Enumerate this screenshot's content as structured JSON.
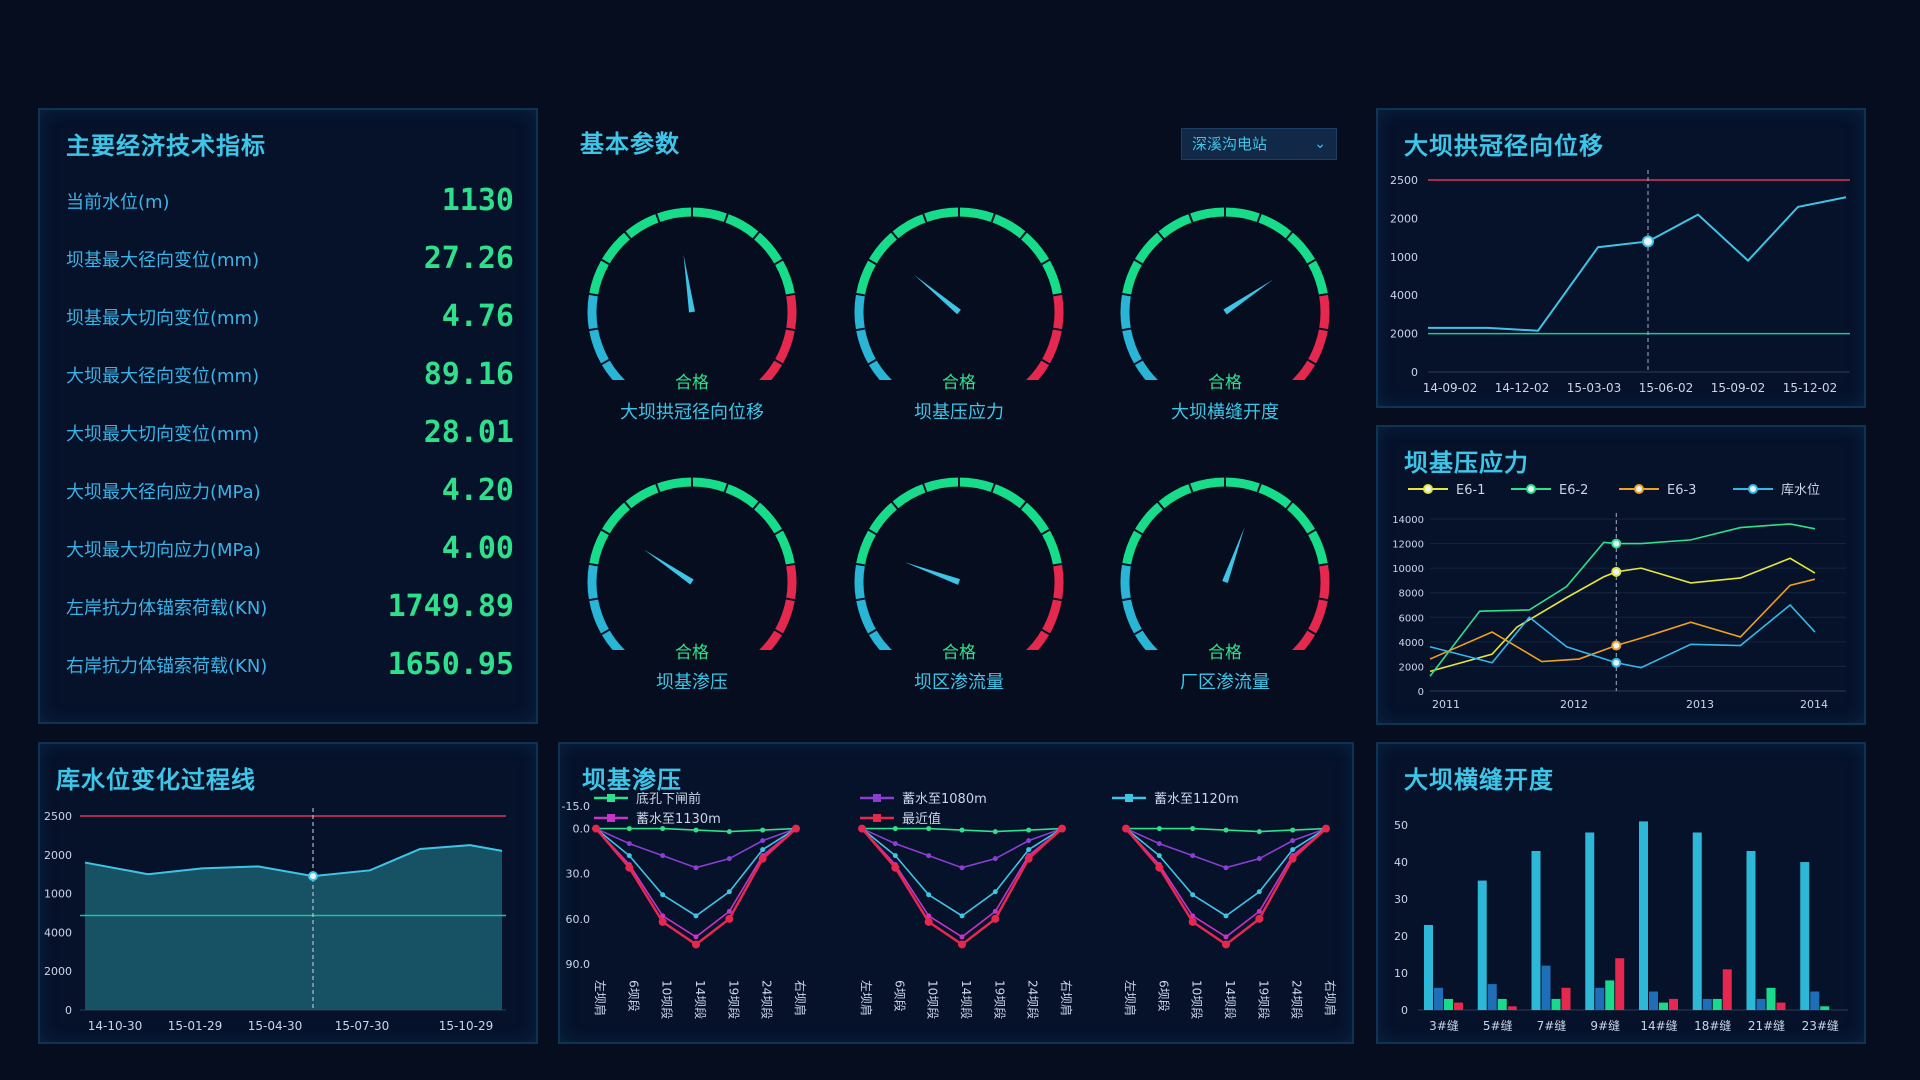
{
  "indicators": {
    "title": "主要经济技术指标",
    "items": [
      {
        "label": "当前水位(m)",
        "value": "1130"
      },
      {
        "label": "坝基最大径向变位(mm)",
        "value": "27.26"
      },
      {
        "label": "坝基最大切向变位(mm)",
        "value": "4.76"
      },
      {
        "label": "大坝最大径向变位(mm)",
        "value": "89.16"
      },
      {
        "label": "大坝最大切向变位(mm)",
        "value": "28.01"
      },
      {
        "label": "大坝最大径向应力(MPa)",
        "value": "4.20"
      },
      {
        "label": "大坝最大切向应力(MPa)",
        "value": "4.00"
      },
      {
        "label": "左岸抗力体锚索荷载(KN)",
        "value": "1749.89"
      },
      {
        "label": "右岸抗力体锚索荷载(KN)",
        "value": "1650.95"
      }
    ]
  },
  "params": {
    "title": "基本参数",
    "station_select": "深溪沟电站",
    "gauges": [
      {
        "name": "大坝拱冠径向位移",
        "status": "合格",
        "level": 0.47
      },
      {
        "name": "坝基压应力",
        "status": "合格",
        "level": 0.32
      },
      {
        "name": "大坝横缝开度",
        "status": "合格",
        "level": 0.7
      },
      {
        "name": "坝基渗压",
        "status": "合格",
        "level": 0.3
      },
      {
        "name": "坝区渗流量",
        "status": "合格",
        "level": 0.25
      },
      {
        "name": "厂区渗流量",
        "status": "合格",
        "level": 0.57
      }
    ]
  },
  "crown": {
    "title": "大坝拱冠径向位移",
    "colors": {
      "line": "#3fc4e6",
      "upper": "#e0325a",
      "lower": "#19c79a"
    }
  },
  "foundation_stress": {
    "title": "坝基压应力",
    "colors": [
      "#e6e63a",
      "#2ee08c",
      "#f0a020",
      "#35b8e8"
    ]
  },
  "reservoir": {
    "title": "库水位变化过程线"
  },
  "seepage": {
    "title": "坝基渗压",
    "colors": [
      "#2ee08c",
      "#8a3fd0",
      "#3fc4e6",
      "#c436c8",
      "#e6284e"
    ]
  },
  "joints": {
    "title": "大坝横缝开度",
    "colors": [
      "#2eb8d8",
      "#1f6fb8",
      "#19d98a",
      "#e6284e"
    ]
  },
  "chart_data": [
    {
      "type": "line",
      "title": "大坝拱冠径向位移",
      "x": [
        "14-09-02",
        "14-12-02",
        "15-03-03",
        "15-06-02",
        "15-09-02",
        "15-12-02"
      ],
      "ytick_labels": [
        "0",
        "2000",
        "4000",
        "1000",
        "2000",
        "2500"
      ],
      "series": [
        {
          "values": [
            0.77,
            0.77,
            0.785,
            0.35,
            0.32,
            0.18,
            0.42,
            0.14,
            0.09
          ]
        }
      ],
      "reference_lines": [
        0.0,
        0.8
      ],
      "highlight_x": "15-06-02",
      "grid": false
    },
    {
      "type": "line",
      "title": "坝基压应力",
      "x_ticks": [
        "2011",
        "2012",
        "2013",
        "2014"
      ],
      "y_ticks": [
        0,
        2000,
        4000,
        6000,
        8000,
        10000,
        12000,
        14000
      ],
      "ylim": [
        0,
        14000
      ],
      "series": [
        {
          "name": "E6-1",
          "x": [
            2010.9,
            2011.4,
            2011.6,
            2012.0,
            2012.3,
            2012.4,
            2012.6,
            2013.0,
            2013.4,
            2013.8,
            2014.0
          ],
          "values": [
            1600,
            3000,
            5200,
            7600,
            9300,
            9700,
            10000,
            8800,
            9200,
            10800,
            9600
          ]
        },
        {
          "name": "E6-2",
          "x": [
            2010.9,
            2011.3,
            2011.7,
            2012.0,
            2012.3,
            2012.4,
            2012.6,
            2013.0,
            2013.4,
            2013.8,
            2014.0
          ],
          "values": [
            1200,
            6500,
            6600,
            8500,
            12100,
            12000,
            12000,
            12300,
            13300,
            13600,
            13200
          ]
        },
        {
          "name": "E6-3",
          "x": [
            2010.9,
            2011.4,
            2011.8,
            2012.1,
            2012.4,
            2012.6,
            2013.0,
            2013.4,
            2013.8,
            2014.0
          ],
          "values": [
            2600,
            4800,
            2400,
            2600,
            3700,
            4300,
            5600,
            4400,
            8600,
            9100
          ]
        },
        {
          "name": "库水位",
          "x": [
            2010.9,
            2011.4,
            2011.7,
            2012.0,
            2012.4,
            2012.6,
            2013.0,
            2013.4,
            2013.8,
            2014.0
          ],
          "values": [
            3600,
            2300,
            6000,
            3600,
            2300,
            1900,
            3800,
            3700,
            7000,
            4800
          ]
        }
      ],
      "highlight_x": 2012.4,
      "legend": "top"
    },
    {
      "type": "area",
      "title": "库水位变化过程线",
      "x": [
        "14-10-30",
        "15-01-29",
        "15-04-30",
        "15-07-30",
        "15-10-29"
      ],
      "ytick_labels": [
        "0",
        "2000",
        "4000",
        "1000",
        "2000",
        "2500"
      ],
      "series": [
        {
          "values": [
            0.24,
            0.3,
            0.27,
            0.26,
            0.31,
            0.28,
            0.17,
            0.15,
            0.18
          ]
        }
      ],
      "reference_lines": [
        0.0,
        0.82
      ],
      "highlight_x": "15-04-30"
    },
    {
      "type": "line",
      "title": "坝基渗压",
      "categories": [
        "左坝肩",
        "6坝段",
        "10坝段",
        "14坝段",
        "19坝段",
        "24坝段",
        "右坝肩"
      ],
      "y_ticks": [
        "-15.0",
        "0.0",
        "30.0",
        "60.0",
        "90.0"
      ],
      "ylim": [
        -15,
        90
      ],
      "groups": 3,
      "series": [
        {
          "name": "底孔下闸前",
          "values": [
            0,
            0,
            0,
            1,
            2,
            1,
            0
          ]
        },
        {
          "name": "蓄水至1080m",
          "values": [
            0,
            10,
            18,
            26,
            20,
            8,
            0
          ]
        },
        {
          "name": "蓄水至1120m",
          "values": [
            0,
            18,
            44,
            58,
            42,
            14,
            0
          ]
        },
        {
          "name": "蓄水至1130m",
          "values": [
            0,
            24,
            58,
            72,
            55,
            18,
            0
          ]
        },
        {
          "name": "最近值",
          "values": [
            0,
            26,
            62,
            77,
            60,
            20,
            0
          ]
        }
      ]
    },
    {
      "type": "bar",
      "title": "大坝横缝开度",
      "categories": [
        "3#缝",
        "5#缝",
        "7#缝",
        "9#缝",
        "14#缝",
        "18#缝",
        "21#缝",
        "23#缝"
      ],
      "y_ticks": [
        0,
        10,
        20,
        30,
        40,
        50
      ],
      "ylim": [
        0,
        53
      ],
      "series": [
        {
          "values": [
            23,
            35,
            43,
            48,
            51,
            48,
            43,
            40
          ]
        },
        {
          "values": [
            6,
            7,
            12,
            6,
            5,
            3,
            3,
            5
          ]
        },
        {
          "values": [
            3,
            3,
            3,
            8,
            2,
            3,
            6,
            1
          ]
        },
        {
          "values": [
            2,
            1,
            6,
            14,
            3,
            11,
            2,
            0
          ]
        }
      ]
    }
  ]
}
